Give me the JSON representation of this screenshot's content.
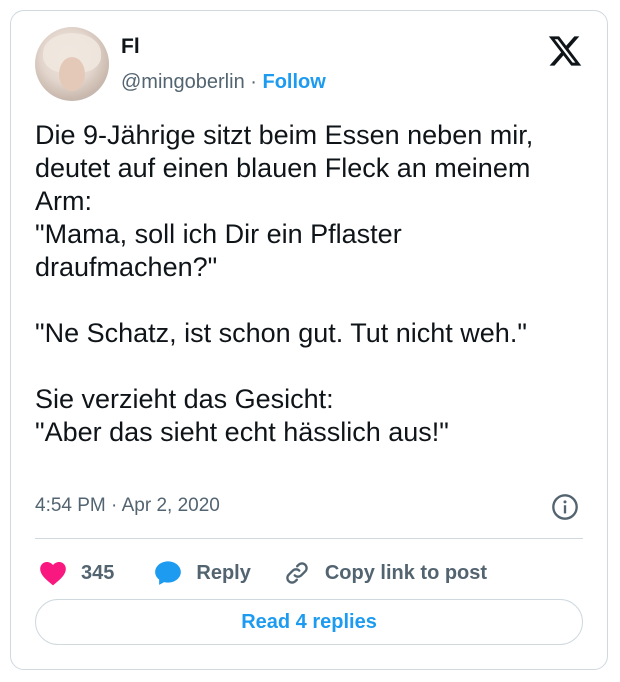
{
  "author": {
    "name": "Fl",
    "handle": "@mingoberlin",
    "separator": "·",
    "follow_label": "Follow"
  },
  "tweet": {
    "text": "Die 9-Jährige sitzt beim Essen neben mir, deutet auf einen blauen Fleck an meinem Arm:\n\"Mama, soll ich Dir ein Pflaster draufmachen?\"\n\n\"Ne Schatz, ist schon gut. Tut nicht weh.\"\n\nSie verzieht das Gesicht:\n\"Aber das sieht echt hässlich aus!\"",
    "timestamp": "4:54 PM · Apr 2, 2020"
  },
  "actions": {
    "like_count": "345",
    "reply_label": "Reply",
    "copy_label": "Copy link to post"
  },
  "read_replies_label": "Read 4 replies",
  "icons": {
    "logo": "x-logo-icon",
    "like": "heart-icon",
    "reply": "speech-bubble-icon",
    "copy": "link-icon",
    "info": "info-icon"
  },
  "colors": {
    "accent": "#1d9bf0",
    "like": "#f91880",
    "text": "#0f1419",
    "muted": "#536471",
    "border": "#cfd9de"
  }
}
